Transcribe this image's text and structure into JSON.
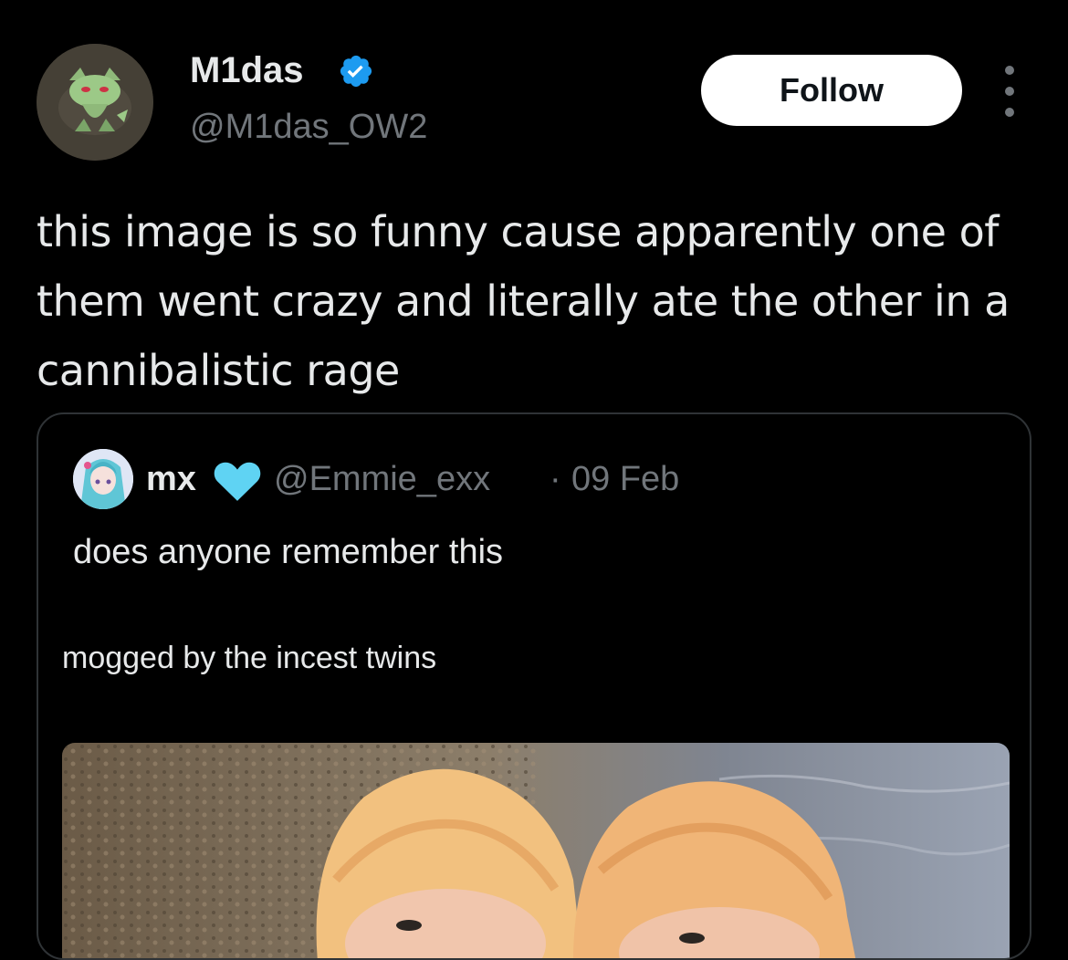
{
  "author": {
    "display_name": "M1das",
    "handle": "@M1das_OW2",
    "verified_icon": "verified-badge-icon"
  },
  "actions": {
    "follow_label": "Follow",
    "more_icon": "more-options-icon"
  },
  "tweet": {
    "text": "this image is so funny cause apparently one of them went crazy and literally ate the other in a cannibalistic rage"
  },
  "quoted": {
    "name": "mx",
    "name_emoji": "light-blue-heart-icon",
    "handle": "@Emmie_exx",
    "separator": "·",
    "date": "09 Feb",
    "text": "does anyone remember this",
    "media_caption": "mogged by the incest twins"
  },
  "colors": {
    "background": "#000000",
    "primary_text": "#e7e9ea",
    "secondary_text": "#71767b",
    "verified": "#1d9bf0",
    "border": "#2f3336"
  }
}
